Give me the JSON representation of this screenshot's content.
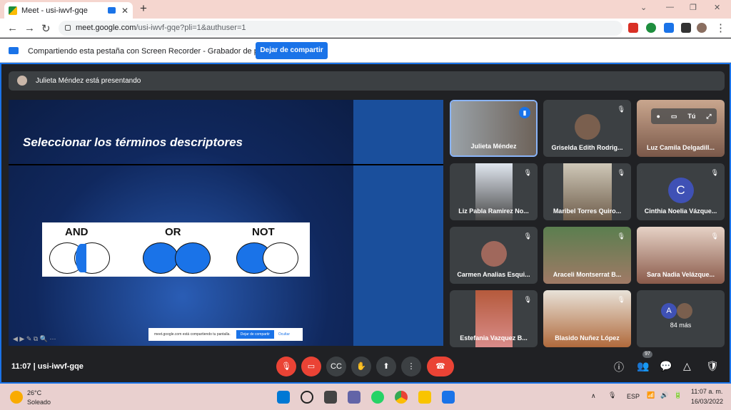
{
  "browser": {
    "tab_title": "Meet - usi-iwvf-gqe",
    "url_host": "meet.google.com",
    "url_path": "/usi-iwvf-gqe?pli=1&authuser=1"
  },
  "infobar": {
    "text": "Compartiendo esta pestaña con Screen Recorder - Grabador de pantalla",
    "stop_button": "Dejar de compartir"
  },
  "presenting": {
    "text": "Julieta Méndez está presentando"
  },
  "slide": {
    "title": "Seleccionar los términos descriptores",
    "venn": [
      "AND",
      "OR",
      "NOT"
    ],
    "share_text": "meet.google.com está compartiendo tu pantalla.",
    "share_stop": "Dejar de compartir",
    "share_hide": "Ocultar"
  },
  "participants": [
    "Julieta Méndez",
    "Griselda Edith Rodrig...",
    "Luz Camila Delgadill...",
    "Liz Pabla Ramirez No...",
    "Maribel Torres Quiro...",
    "Cinthia Noelia Vázque...",
    "Carmen Analias Esqui...",
    "Araceli Montserrat B...",
    "Sara Nadia Velázque...",
    "Estefania Vazquez B...",
    "Blasido Nuñez López",
    "84 más"
  ],
  "self_tile": {
    "label": "Tú"
  },
  "cinthia_initial": "C",
  "more_initial": "A",
  "controls": {
    "time": "11:07",
    "meeting_code": "usi-iwvf-gqe",
    "people_count": "97"
  },
  "taskbar": {
    "temp": "26°C",
    "weather": "Soleado",
    "lang": "ESP",
    "clock_time": "11:07 a. m.",
    "clock_date": "16/03/2022"
  }
}
